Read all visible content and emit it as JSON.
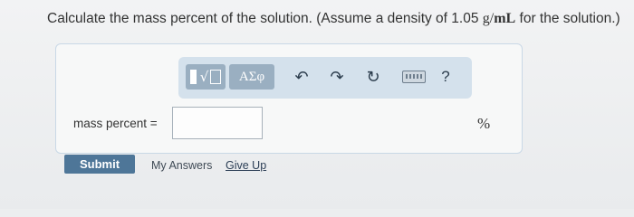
{
  "question": {
    "prefix": "Calculate the mass percent of the solution. (Assume a density of 1.05 ",
    "unit_g": "g",
    "unit_sep": "/",
    "unit_ml": "mL",
    "suffix": " for the solution.)"
  },
  "toolbar": {
    "symbols_label": "ΑΣφ",
    "undo_icon": "↶",
    "redo_icon": "↷",
    "reset_icon": "↻",
    "help_label": "?"
  },
  "answer": {
    "label": "mass percent =",
    "value": "",
    "unit": "%"
  },
  "actions": {
    "submit_label": "Submit",
    "my_answers_label": "My Answers",
    "give_up_label": "Give Up"
  },
  "colors": {
    "submit_bg": "#4e7698",
    "toolbar_bg": "#d4e1ec",
    "toolbar_button_bg": "#9aafc1"
  }
}
